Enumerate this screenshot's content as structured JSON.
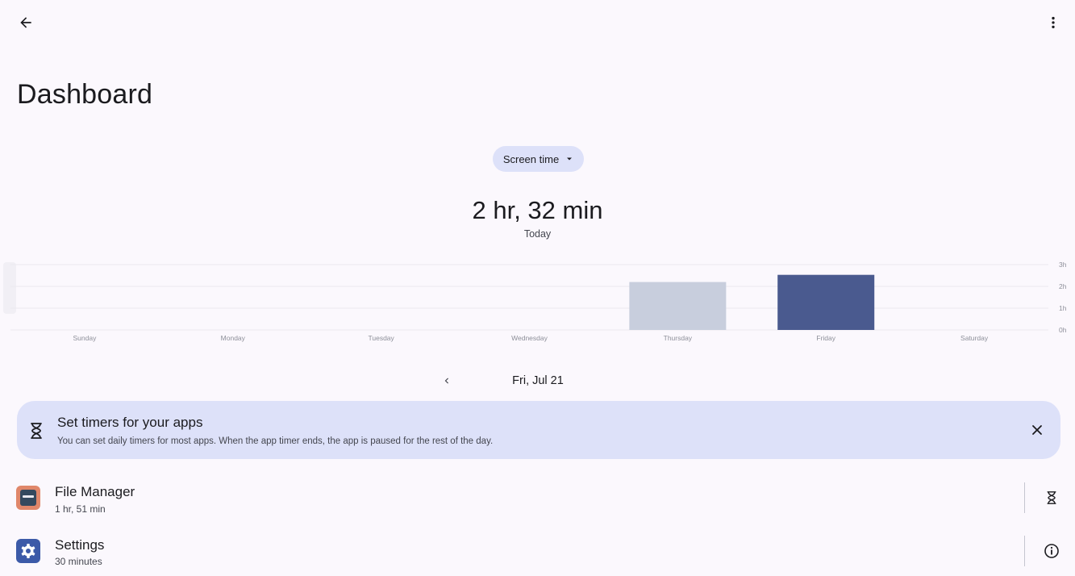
{
  "header": {
    "back_icon": "arrow-back-icon",
    "more_icon": "more-vert-icon",
    "title": "Dashboard"
  },
  "metric_selector": {
    "label": "Screen time",
    "icon": "dropdown-arrow-icon"
  },
  "summary": {
    "total": "2 hr, 32 min",
    "period": "Today"
  },
  "chart_data": {
    "type": "bar",
    "categories": [
      "Sunday",
      "Monday",
      "Tuesday",
      "Wednesday",
      "Thursday",
      "Friday",
      "Saturday"
    ],
    "values": [
      0,
      0,
      0,
      0,
      2.2,
      2.53,
      0
    ],
    "selected_index": 5,
    "y_ticks": [
      "3h",
      "2h",
      "1h",
      "0h"
    ],
    "ylim": [
      0,
      3
    ],
    "grid": true,
    "colors": {
      "selected": "#4a5a8f",
      "other": "#c8cedd",
      "grid": "#ebe9f0",
      "tick": "#8d8f99"
    }
  },
  "date_nav": {
    "prev_icon": "chevron-left-icon",
    "label": "Fri, Jul 21"
  },
  "tip_card": {
    "icon": "hourglass-icon",
    "title": "Set timers for your apps",
    "body": "You can set daily timers for most apps. When the app timer ends, the app is paused for the rest of the day.",
    "close_icon": "close-icon"
  },
  "apps": [
    {
      "name": "File Manager",
      "usage": "1 hr, 51 min",
      "icon": "file-manager-icon",
      "action_icon": "hourglass-icon"
    },
    {
      "name": "Settings",
      "usage": "30 minutes",
      "icon": "settings-gear-icon",
      "action_icon": "info-icon"
    }
  ],
  "colors": {
    "background": "#fbf8fd",
    "chip": "#dde1f9",
    "accent": "#4a5a8f"
  }
}
